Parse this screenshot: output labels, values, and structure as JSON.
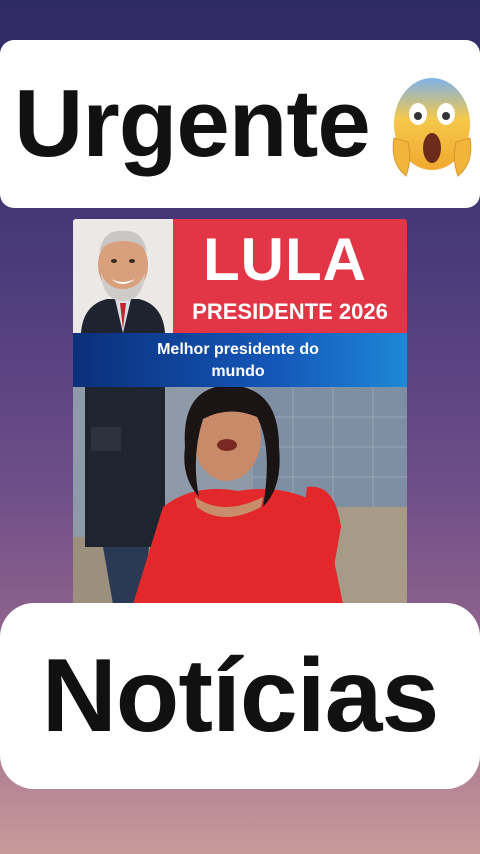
{
  "top_banner": {
    "text": "Urgente",
    "emoji_icon": "face-screaming-in-fear-icon"
  },
  "card": {
    "portrait_icon": "smiling-politician-portrait",
    "name": "LULA",
    "subtitle": "PRESIDENTE 2026",
    "caption_line1": "Melhor presidente do",
    "caption_line2": "mundo",
    "photo_description": "woman-in-red-dress-street-photo"
  },
  "bottom_banner": {
    "text": "Notícias"
  },
  "colors": {
    "accent_red": "#e23545",
    "caption_blue": "#1457b8",
    "banner_white": "#ffffff"
  }
}
